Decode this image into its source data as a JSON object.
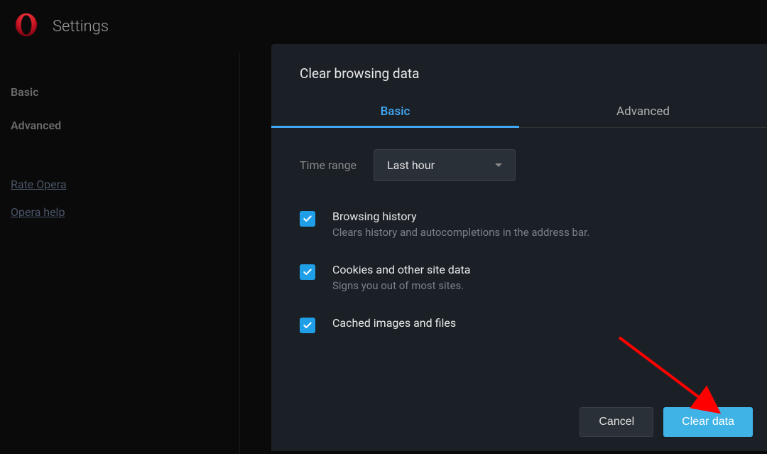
{
  "header": {
    "title": "Settings"
  },
  "sidebar": {
    "items": [
      {
        "label": "Basic"
      },
      {
        "label": "Advanced"
      }
    ],
    "links": [
      {
        "label": "Rate Opera"
      },
      {
        "label": "Opera help"
      }
    ]
  },
  "dialog": {
    "title": "Clear browsing data",
    "tabs": [
      {
        "label": "Basic",
        "active": true
      },
      {
        "label": "Advanced",
        "active": false
      }
    ],
    "time_range": {
      "label": "Time range",
      "value": "Last hour"
    },
    "options": [
      {
        "checked": true,
        "title": "Browsing history",
        "desc": "Clears history and autocompletions in the address bar."
      },
      {
        "checked": true,
        "title": "Cookies and other site data",
        "desc": "Signs you out of most sites."
      },
      {
        "checked": true,
        "title": "Cached images and files",
        "desc": ""
      }
    ],
    "buttons": {
      "cancel": "Cancel",
      "clear": "Clear data"
    }
  },
  "colors": {
    "accent": "#41a8f5",
    "checkbox": "#1f9fe8",
    "primary_btn": "#3fb3e6"
  }
}
